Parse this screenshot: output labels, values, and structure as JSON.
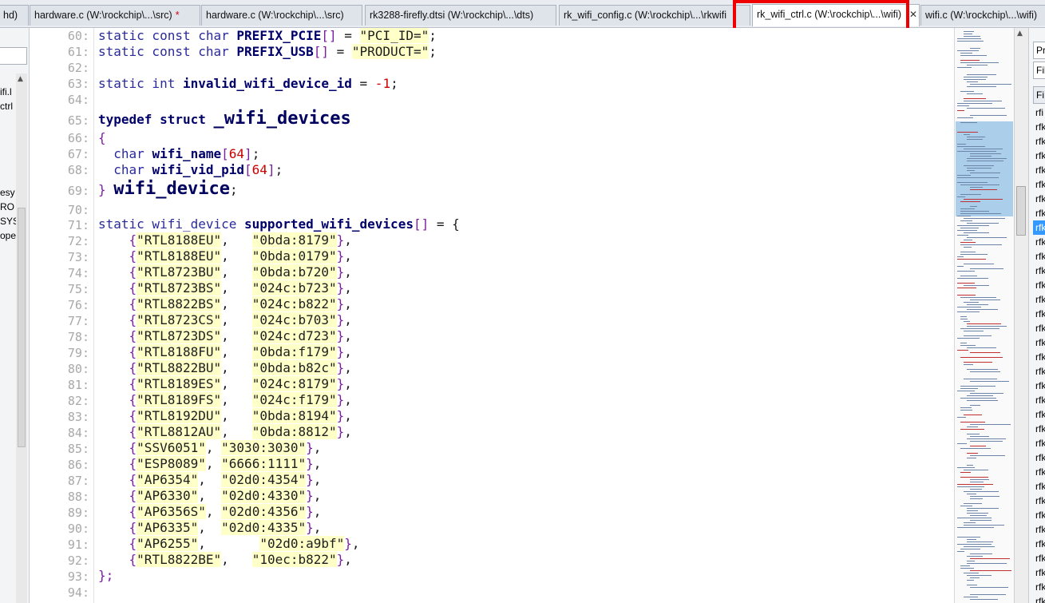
{
  "tabs": [
    {
      "label": "hd)",
      "modified": false,
      "active": false,
      "close": ""
    },
    {
      "label": "hardware.c (W:\\rockchip\\...\\src)",
      "modified": true,
      "active": false,
      "close": ""
    },
    {
      "label": "hardware.c (W:\\rockchip\\...\\src)",
      "modified": false,
      "active": false,
      "close": ""
    },
    {
      "label": "rk3288-firefly.dtsi (W:\\rockchip\\...\\dts)",
      "modified": false,
      "active": false,
      "close": ""
    },
    {
      "label": "rk_wifi_config.c (W:\\rockchip\\...\\rkwifi",
      "modified": false,
      "active": false,
      "close": ""
    },
    {
      "label": "rk_wifi_ctrl.c (W:\\rockchip\\...\\wifi)",
      "modified": false,
      "active": true,
      "close": "✕"
    },
    {
      "label": "wifi.c (W:\\rockchip\\...\\wifi)",
      "modified": false,
      "active": false,
      "close": ""
    }
  ],
  "modified_marker": "*",
  "left_panel": {
    "items": [
      "ifi.l",
      "ctrl",
      "esy",
      "RO",
      "SYS",
      "ope"
    ]
  },
  "right_panel": {
    "boxes": [
      "Pr",
      "Fil",
      "Fi"
    ],
    "items": [
      "rfi",
      "rfk",
      "rfk",
      "rfk",
      "rfk",
      "rfk",
      "rfk",
      "rfk",
      "rfk",
      "rfk",
      "rfk",
      "rfk",
      "rfk",
      "rfk",
      "rfk",
      "rfk",
      "rfk",
      "rfk",
      "rfk",
      "rfk",
      "rfk",
      "rfk",
      "rfk",
      "rfk",
      "rfk",
      "rfk",
      "rfk",
      "rfk",
      "rfk",
      "rfk",
      "rfk",
      "rfk",
      "rfk",
      "rfk",
      "rfk"
    ],
    "selected_index": 8
  },
  "code": {
    "line_numbers": [
      "60:",
      "61:",
      "62:",
      "63:",
      "64:",
      "65:",
      "66:",
      "67:",
      "68:",
      "69:",
      "70:",
      "71:",
      "72:",
      "73:",
      "74:",
      "75:",
      "76:",
      "77:",
      "78:",
      "79:",
      "80:",
      "81:",
      "82:",
      "83:",
      "84:",
      "85:",
      "86:",
      "87:",
      "88:",
      "89:",
      "90:",
      "91:",
      "92:",
      "93:",
      "94:"
    ],
    "prefix_pcie": {
      "decl": "static const char ",
      "name": "PREFIX_PCIE",
      "value": "\"PCI_ID=\""
    },
    "prefix_usb": {
      "decl": "static const char ",
      "name": "PREFIX_USB",
      "value": "\"PRODUCT=\""
    },
    "invalid_id": {
      "decl": "static int ",
      "name": "invalid_wifi_device_id",
      "eq": " = ",
      "minus": "-",
      "value": "1"
    },
    "struct_head": {
      "keyword": "typedef struct ",
      "name": "_wifi_devices"
    },
    "open_brace": "{",
    "member1": {
      "type": "char ",
      "name": "wifi_name",
      "size": "64"
    },
    "member2": {
      "type": "char ",
      "name": "wifi_vid_pid",
      "size": "64"
    },
    "struct_close": {
      "brace": "}",
      "typename": "wifi_device"
    },
    "array_decl": {
      "decl": "static wifi_device ",
      "name": "supported_wifi_devices",
      "tail": " = {"
    },
    "devices": [
      {
        "name": "\"RTL8188EU\"",
        "pad": "   ",
        "id": "\"0bda:8179\""
      },
      {
        "name": "\"RTL8188EU\"",
        "pad": "   ",
        "id": "\"0bda:0179\""
      },
      {
        "name": "\"RTL8723BU\"",
        "pad": "   ",
        "id": "\"0bda:b720\""
      },
      {
        "name": "\"RTL8723BS\"",
        "pad": "   ",
        "id": "\"024c:b723\""
      },
      {
        "name": "\"RTL8822BS\"",
        "pad": "   ",
        "id": "\"024c:b822\""
      },
      {
        "name": "\"RTL8723CS\"",
        "pad": "   ",
        "id": "\"024c:b703\""
      },
      {
        "name": "\"RTL8723DS\"",
        "pad": "   ",
        "id": "\"024c:d723\""
      },
      {
        "name": "\"RTL8188FU\"",
        "pad": "   ",
        "id": "\"0bda:f179\""
      },
      {
        "name": "\"RTL8822BU\"",
        "pad": "   ",
        "id": "\"0bda:b82c\""
      },
      {
        "name": "\"RTL8189ES\"",
        "pad": "   ",
        "id": "\"024c:8179\""
      },
      {
        "name": "\"RTL8189FS\"",
        "pad": "   ",
        "id": "\"024c:f179\""
      },
      {
        "name": "\"RTL8192DU\"",
        "pad": "   ",
        "id": "\"0bda:8194\""
      },
      {
        "name": "\"RTL8812AU\"",
        "pad": "   ",
        "id": "\"0bda:8812\""
      },
      {
        "name": "\"SSV6051\"",
        "pad": " ",
        "id": "\"3030:3030\""
      },
      {
        "name": "\"ESP8089\"",
        "pad": " ",
        "id": "\"6666:1111\""
      },
      {
        "name": "\"AP6354\"",
        "pad": "  ",
        "id": "\"02d0:4354\""
      },
      {
        "name": "\"AP6330\"",
        "pad": "  ",
        "id": "\"02d0:4330\""
      },
      {
        "name": "\"AP6356S\"",
        "pad": " ",
        "id": "\"02d0:4356\""
      },
      {
        "name": "\"AP6335\"",
        "pad": "  ",
        "id": "\"02d0:4335\""
      },
      {
        "name": "\"AP6255\"",
        "pad": "       ",
        "id": "\"02d0:a9bf\""
      },
      {
        "name": "\"RTL8822BE\"",
        "pad": "   ",
        "id": "\"10ec:b822\""
      }
    ],
    "array_close": "};"
  }
}
